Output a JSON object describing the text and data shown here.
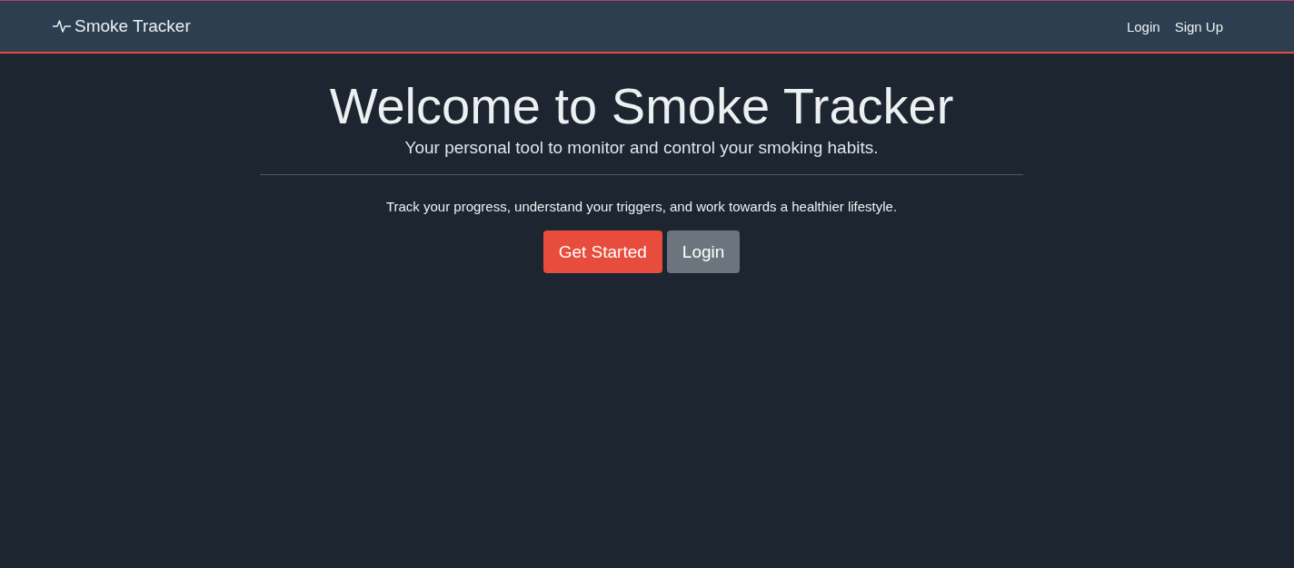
{
  "navbar": {
    "brand": "Smoke Tracker",
    "links": [
      {
        "label": "Login"
      },
      {
        "label": "Sign Up"
      }
    ]
  },
  "hero": {
    "title": "Welcome to Smoke Tracker",
    "subtitle": "Your personal tool to monitor and control your smoking habits.",
    "text": "Track your progress, understand your triggers, and work towards a healthier lifestyle.",
    "buttons": [
      {
        "label": "Get Started",
        "kind": "primary"
      },
      {
        "label": "Login",
        "kind": "secondary"
      }
    ]
  }
}
